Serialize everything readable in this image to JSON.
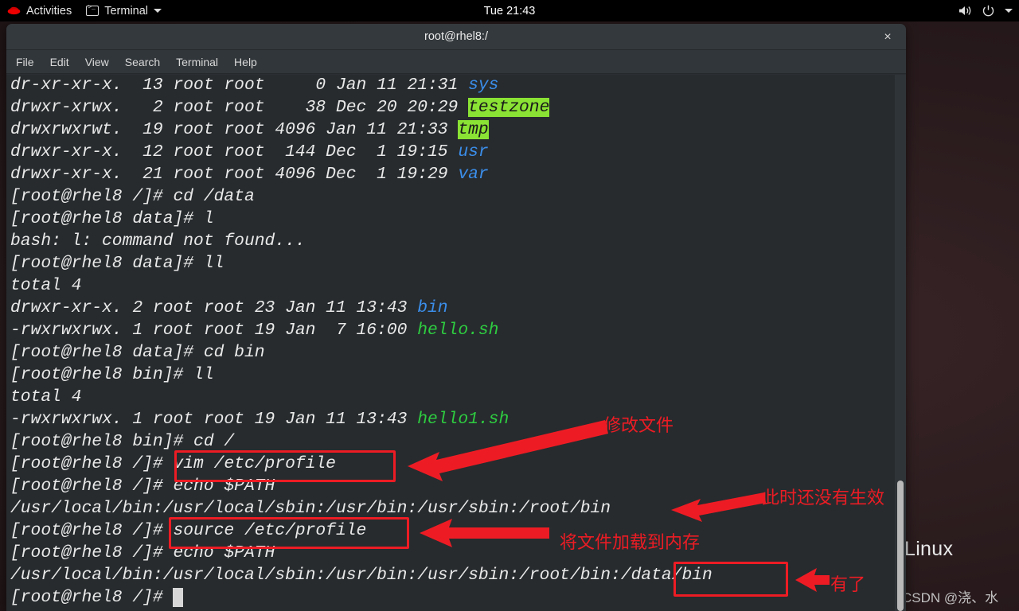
{
  "topbar": {
    "activities_label": "Activities",
    "app_label": "Terminal",
    "clock": "Tue 21:43",
    "icons": {
      "redhat": "redhat-logo-icon",
      "terminal": "terminal-icon",
      "caret": "chevron-down-icon",
      "volume": "volume-icon",
      "power": "power-icon",
      "tray_caret": "chevron-down-icon"
    }
  },
  "window": {
    "title": "root@rhel8:/",
    "close_label": "×",
    "menu": [
      "File",
      "Edit",
      "View",
      "Search",
      "Terminal",
      "Help"
    ]
  },
  "terminal": {
    "lines": [
      {
        "id": "ls-sys",
        "parts": [
          {
            "t": "dr-xr-xr-x.  13 root root     0 Jan 11 21:31 ",
            "c": "plain"
          },
          {
            "t": "sys",
            "c": "blue"
          }
        ]
      },
      {
        "id": "ls-testzone",
        "parts": [
          {
            "t": "drwxr-xrwx.   2 root root    38 Dec 20 20:29 ",
            "c": "plain"
          },
          {
            "t": "testzone",
            "c": "hl"
          }
        ]
      },
      {
        "id": "ls-tmp",
        "parts": [
          {
            "t": "drwxrwxrwt.  19 root root 4096 Jan 11 21:33 ",
            "c": "plain"
          },
          {
            "t": "tmp",
            "c": "hl"
          }
        ]
      },
      {
        "id": "ls-usr",
        "parts": [
          {
            "t": "drwxr-xr-x.  12 root root  144 Dec  1 19:15 ",
            "c": "plain"
          },
          {
            "t": "usr",
            "c": "blue"
          }
        ]
      },
      {
        "id": "ls-var",
        "parts": [
          {
            "t": "drwxr-xr-x.  21 root root 4096 Dec  1 19:29 ",
            "c": "plain"
          },
          {
            "t": "var",
            "c": "blue"
          }
        ]
      },
      {
        "id": "cmd-cd-data",
        "parts": [
          {
            "t": "[root@rhel8 /]# cd /data",
            "c": "plain"
          }
        ]
      },
      {
        "id": "cmd-l",
        "parts": [
          {
            "t": "[root@rhel8 data]# l",
            "c": "plain"
          }
        ]
      },
      {
        "id": "out-notfound",
        "parts": [
          {
            "t": "bash: l: command not found...",
            "c": "plain"
          }
        ]
      },
      {
        "id": "cmd-ll-data",
        "parts": [
          {
            "t": "[root@rhel8 data]# ll",
            "c": "plain"
          }
        ]
      },
      {
        "id": "out-total-1",
        "parts": [
          {
            "t": "total 4",
            "c": "plain"
          }
        ]
      },
      {
        "id": "ls-bin",
        "parts": [
          {
            "t": "drwxr-xr-x. 2 root root 23 Jan 11 13:43 ",
            "c": "plain"
          },
          {
            "t": "bin",
            "c": "blue"
          }
        ]
      },
      {
        "id": "ls-hello",
        "parts": [
          {
            "t": "-rwxrwxrwx. 1 root root 19 Jan  7 16:00 ",
            "c": "plain"
          },
          {
            "t": "hello.sh",
            "c": "green"
          }
        ]
      },
      {
        "id": "cmd-cd-bin",
        "parts": [
          {
            "t": "[root@rhel8 data]# cd bin",
            "c": "plain"
          }
        ]
      },
      {
        "id": "cmd-ll-bin",
        "parts": [
          {
            "t": "[root@rhel8 bin]# ll",
            "c": "plain"
          }
        ]
      },
      {
        "id": "out-total-2",
        "parts": [
          {
            "t": "total 4",
            "c": "plain"
          }
        ]
      },
      {
        "id": "ls-hello1",
        "parts": [
          {
            "t": "-rwxrwxrwx. 1 root root 19 Jan 11 13:43 ",
            "c": "plain"
          },
          {
            "t": "hello1.sh",
            "c": "green"
          }
        ]
      },
      {
        "id": "cmd-cd-root",
        "parts": [
          {
            "t": "[root@rhel8 bin]# cd /",
            "c": "plain"
          }
        ]
      },
      {
        "id": "cmd-vim",
        "parts": [
          {
            "t": "[root@rhel8 /]# vim /etc/profile",
            "c": "plain"
          }
        ]
      },
      {
        "id": "cmd-echo-1",
        "parts": [
          {
            "t": "[root@rhel8 /]# echo $PATH",
            "c": "plain"
          }
        ]
      },
      {
        "id": "out-path-1",
        "parts": [
          {
            "t": "/usr/local/bin:/usr/local/sbin:/usr/bin:/usr/sbin:/root/bin",
            "c": "plain"
          }
        ]
      },
      {
        "id": "cmd-source",
        "parts": [
          {
            "t": "[root@rhel8 /]# source /etc/profile",
            "c": "plain"
          }
        ]
      },
      {
        "id": "cmd-echo-2",
        "parts": [
          {
            "t": "[root@rhel8 /]# echo $PATH",
            "c": "plain"
          }
        ]
      },
      {
        "id": "out-path-2",
        "parts": [
          {
            "t": "/usr/local/bin:/usr/local/sbin:/usr/bin:/usr/sbin:/root/bin:/data/bin",
            "c": "plain"
          }
        ]
      },
      {
        "id": "prompt-last",
        "parts": [
          {
            "t": "[root@rhel8 /]# ",
            "c": "plain"
          },
          {
            "t": " ",
            "c": "cursor"
          }
        ]
      }
    ]
  },
  "annotations": [
    {
      "id": "note-modify-file",
      "text": "修改文件"
    },
    {
      "id": "note-not-effective",
      "text": "此时还没有生效"
    },
    {
      "id": "note-load-memory",
      "text": "将文件加载到内存"
    },
    {
      "id": "note-now-present",
      "text": "有了"
    }
  ],
  "desktop": {
    "label": "Linux",
    "watermark": "CSDN @浇、水"
  },
  "colors": {
    "annotation_red": "#ec1c24",
    "terminal_bg": "#272b2e",
    "dir_blue": "#3b8eea",
    "exec_green": "#2ecc40",
    "highlight_green": "#8ae234"
  }
}
